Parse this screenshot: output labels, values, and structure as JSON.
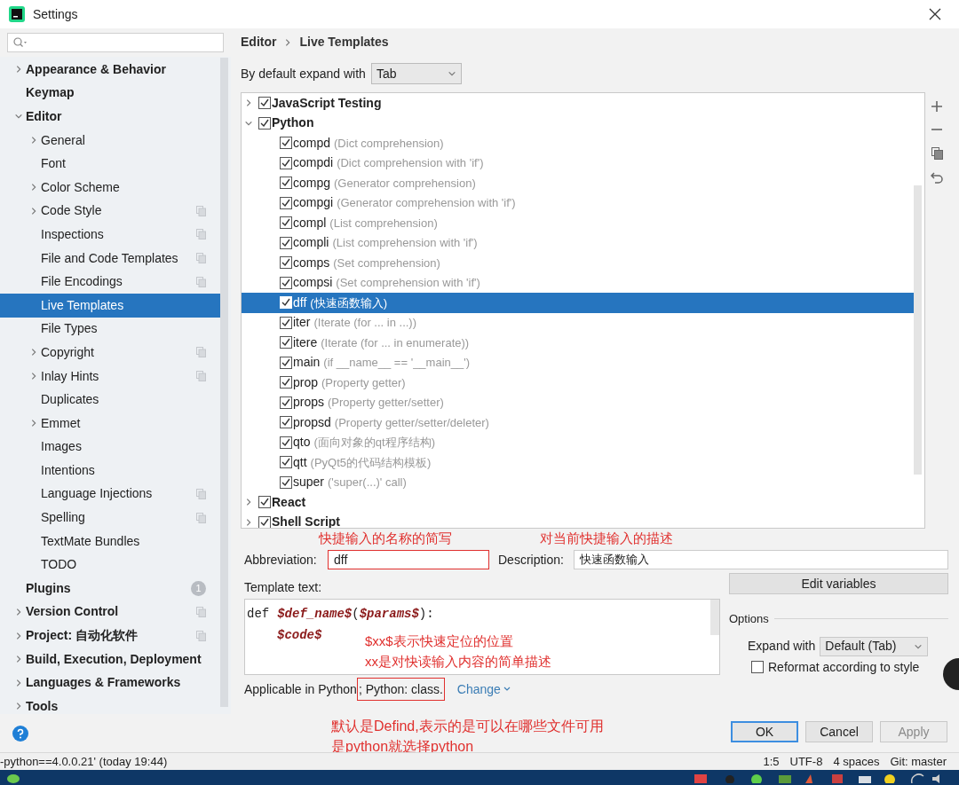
{
  "window": {
    "title": "Settings"
  },
  "sidebar": {
    "items": [
      {
        "label": "Appearance & Behavior",
        "expandable": true,
        "expanded": false,
        "selected": false,
        "shared": false
      },
      {
        "label": "Keymap",
        "expandable": false,
        "selected": false,
        "shared": false
      },
      {
        "label": "Editor",
        "expandable": true,
        "expanded": true,
        "selected": false,
        "shared": false,
        "children": [
          {
            "label": "General",
            "expandable": true,
            "expanded": false,
            "selected": false,
            "shared": false
          },
          {
            "label": "Font",
            "expandable": false,
            "selected": false,
            "shared": false
          },
          {
            "label": "Color Scheme",
            "expandable": true,
            "expanded": false,
            "selected": false,
            "shared": false
          },
          {
            "label": "Code Style",
            "expandable": true,
            "expanded": false,
            "selected": false,
            "shared": true
          },
          {
            "label": "Inspections",
            "expandable": false,
            "selected": false,
            "shared": true
          },
          {
            "label": "File and Code Templates",
            "expandable": false,
            "selected": false,
            "shared": true
          },
          {
            "label": "File Encodings",
            "expandable": false,
            "selected": false,
            "shared": true
          },
          {
            "label": "Live Templates",
            "expandable": false,
            "selected": true,
            "shared": false
          },
          {
            "label": "File Types",
            "expandable": false,
            "selected": false,
            "shared": false
          },
          {
            "label": "Copyright",
            "expandable": true,
            "expanded": false,
            "selected": false,
            "shared": true
          },
          {
            "label": "Inlay Hints",
            "expandable": true,
            "expanded": false,
            "selected": false,
            "shared": true
          },
          {
            "label": "Duplicates",
            "expandable": false,
            "selected": false,
            "shared": false
          },
          {
            "label": "Emmet",
            "expandable": true,
            "expanded": false,
            "selected": false,
            "shared": false
          },
          {
            "label": "Images",
            "expandable": false,
            "selected": false,
            "shared": false
          },
          {
            "label": "Intentions",
            "expandable": false,
            "selected": false,
            "shared": false
          },
          {
            "label": "Language Injections",
            "expandable": false,
            "selected": false,
            "shared": true
          },
          {
            "label": "Spelling",
            "expandable": false,
            "selected": false,
            "shared": true
          },
          {
            "label": "TextMate Bundles",
            "expandable": false,
            "selected": false,
            "shared": false
          },
          {
            "label": "TODO",
            "expandable": false,
            "selected": false,
            "shared": false
          }
        ]
      },
      {
        "label": "Plugins",
        "expandable": false,
        "selected": false,
        "shared": false,
        "badge": "1"
      },
      {
        "label": "Version Control",
        "expandable": true,
        "expanded": false,
        "selected": false,
        "shared": true
      },
      {
        "label": "Project: 自动化软件",
        "expandable": true,
        "expanded": false,
        "selected": false,
        "shared": true
      },
      {
        "label": "Build, Execution, Deployment",
        "expandable": true,
        "expanded": false,
        "selected": false,
        "shared": false
      },
      {
        "label": "Languages & Frameworks",
        "expandable": true,
        "expanded": false,
        "selected": false,
        "shared": false
      },
      {
        "label": "Tools",
        "expandable": true,
        "expanded": false,
        "selected": false,
        "shared": false
      }
    ]
  },
  "breadcrumb": [
    "Editor",
    "Live Templates"
  ],
  "expand_default": {
    "label": "By default expand with",
    "value": "Tab"
  },
  "template_groups": [
    {
      "name": "JavaScript Testing",
      "checked": true,
      "expanded": false,
      "selected": false
    },
    {
      "name": "Python",
      "checked": true,
      "expanded": true,
      "selected": false,
      "templates": [
        {
          "abbreviation": "compd",
          "description": "(Dict comprehension)",
          "checked": true,
          "selected": false
        },
        {
          "abbreviation": "compdi",
          "description": "(Dict comprehension with 'if')",
          "checked": true,
          "selected": false
        },
        {
          "abbreviation": "compg",
          "description": "(Generator comprehension)",
          "checked": true,
          "selected": false
        },
        {
          "abbreviation": "compgi",
          "description": "(Generator comprehension with 'if')",
          "checked": true,
          "selected": false
        },
        {
          "abbreviation": "compl",
          "description": "(List comprehension)",
          "checked": true,
          "selected": false
        },
        {
          "abbreviation": "compli",
          "description": "(List comprehension with 'if')",
          "checked": true,
          "selected": false
        },
        {
          "abbreviation": "comps",
          "description": "(Set comprehension)",
          "checked": true,
          "selected": false
        },
        {
          "abbreviation": "compsi",
          "description": "(Set comprehension with 'if')",
          "checked": true,
          "selected": false
        },
        {
          "abbreviation": "dff",
          "description": "(快速函数输入)",
          "checked": true,
          "selected": true
        },
        {
          "abbreviation": "iter",
          "description": "(Iterate (for ... in ...))",
          "checked": true,
          "selected": false
        },
        {
          "abbreviation": "itere",
          "description": "(Iterate (for ... in enumerate))",
          "checked": true,
          "selected": false
        },
        {
          "abbreviation": "main",
          "description": "(if __name__ == '__main__')",
          "checked": true,
          "selected": false
        },
        {
          "abbreviation": "prop",
          "description": "(Property getter)",
          "checked": true,
          "selected": false
        },
        {
          "abbreviation": "props",
          "description": "(Property getter/setter)",
          "checked": true,
          "selected": false
        },
        {
          "abbreviation": "propsd",
          "description": "(Property getter/setter/deleter)",
          "checked": true,
          "selected": false
        },
        {
          "abbreviation": "qto",
          "description": "(面向对象的qt程序结构)",
          "checked": true,
          "selected": false
        },
        {
          "abbreviation": "qtt",
          "description": "(PyQt5的代码结构模板)",
          "checked": true,
          "selected": false
        },
        {
          "abbreviation": "super",
          "description": "('super(...)' call)",
          "checked": true,
          "selected": false
        }
      ]
    },
    {
      "name": "React",
      "checked": true,
      "expanded": false,
      "selected": false
    },
    {
      "name": "Shell Script",
      "checked": true,
      "expanded": false,
      "selected": false
    }
  ],
  "abbreviation": {
    "label": "Abbreviation:",
    "value": "dff"
  },
  "description": {
    "label": "Description:",
    "value": "快速函数输入"
  },
  "template_text": {
    "label": "Template text:",
    "lines": [
      {
        "indented": false,
        "tokens": [
          {
            "kind": "plain",
            "text": "def"
          },
          {
            "kind": "variable",
            "text": "$def_name$"
          },
          {
            "kind": "plain",
            "text": "("
          },
          {
            "kind": "variable",
            "text": "$params$"
          },
          {
            "kind": "plain",
            "text": "):"
          }
        ]
      },
      {
        "indented": true,
        "tokens": [
          {
            "kind": "variable",
            "text": "$code$"
          }
        ]
      }
    ]
  },
  "applicable": {
    "label": "Applicable in Python",
    "contexts": "; Python: class.",
    "change": "Change"
  },
  "edit_variables": "Edit variables",
  "options": {
    "title": "Options",
    "expand_with": {
      "label": "Expand with",
      "value": "Default (Tab)"
    },
    "reformat": {
      "label": "Reformat according to style",
      "checked": false
    }
  },
  "buttons": [
    {
      "label": "OK",
      "default": true,
      "disabled": false
    },
    {
      "label": "Cancel",
      "default": false,
      "disabled": false
    },
    {
      "label": "Apply",
      "default": false,
      "disabled": true
    }
  ],
  "annotations": {
    "abbreviation_note": "快捷输入的名称的简写",
    "description_note": "对当前快捷输入的描述",
    "template_notes": [
      "$xx$表示快速定位的位置",
      "xx是对快读输入内容的简单描述"
    ],
    "context_notes": [
      "默认是Defind,表示的是可以在哪些文件可用",
      "是python就选择python"
    ]
  },
  "status_bar": {
    "left": "-python==4.0.0.21' (today 19:44)",
    "items": [
      "1:5",
      "UTF-8",
      "4 spaces",
      "Git: master"
    ]
  }
}
